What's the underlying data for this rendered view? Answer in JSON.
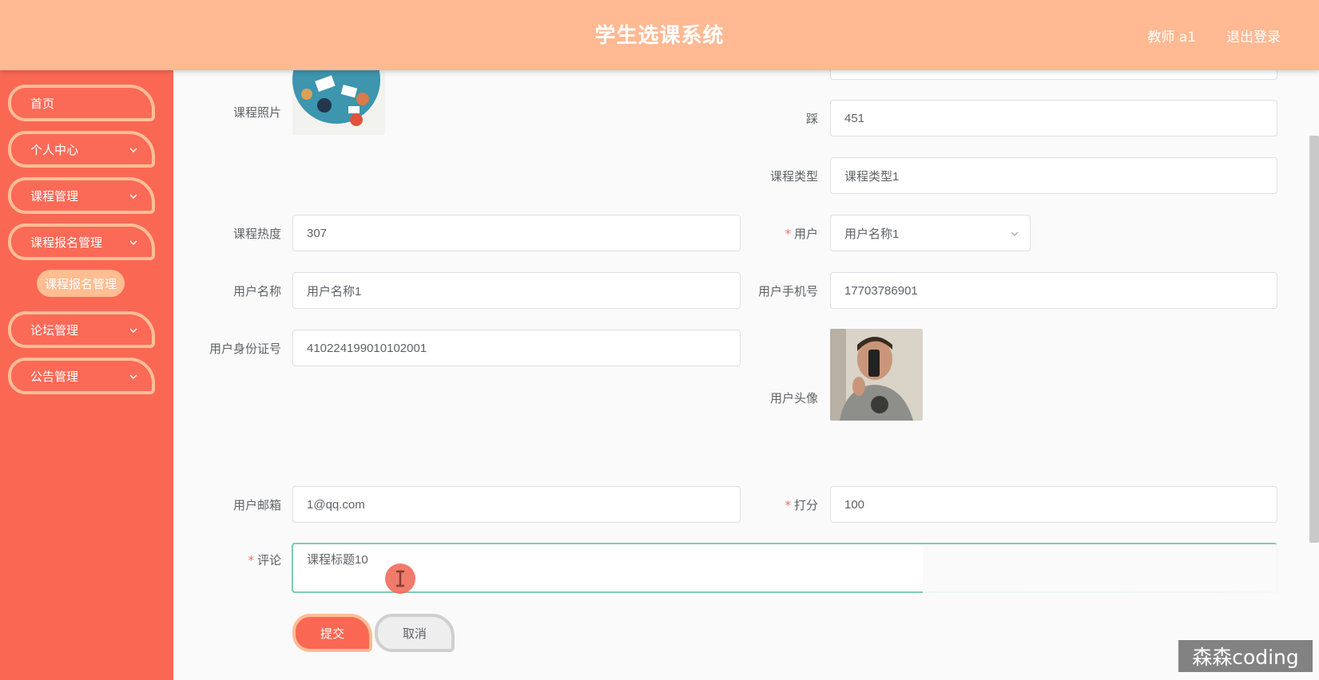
{
  "header": {
    "title": "学生选课系统",
    "user": "教师 a1",
    "logout": "退出登录"
  },
  "sidebar": {
    "items": [
      {
        "label": "首页"
      },
      {
        "label": "个人中心"
      },
      {
        "label": "课程管理"
      },
      {
        "label": "课程报名管理"
      },
      {
        "label": "论坛管理"
      },
      {
        "label": "公告管理"
      }
    ],
    "submenu_active": "课程报名管理"
  },
  "form": {
    "course_photo_label": "课程照片",
    "cai_label": "踩",
    "cai_value": "451",
    "course_type_label": "课程类型",
    "course_type_value": "课程类型1",
    "heat_label": "课程热度",
    "heat_value": "307",
    "user_label": "用户",
    "user_select_value": "用户名称1",
    "username_label": "用户名称",
    "username_value": "用户名称1",
    "phone_label": "用户手机号",
    "phone_value": "17703786901",
    "idcard_label": "用户身份证号",
    "idcard_value": "410224199010102001",
    "avatar_label": "用户头像",
    "email_label": "用户邮箱",
    "email_value": "1@qq.com",
    "score_label": "打分",
    "score_value": "100",
    "comment_label": "评论",
    "comment_value": "课程标题10",
    "required_mark": "*"
  },
  "buttons": {
    "submit": "提交",
    "cancel": "取消"
  },
  "watermark": "森森coding",
  "colors": {
    "header_bg": "#ffb993",
    "sidebar_bg": "#fa6854",
    "accent_border": "#ffbe97",
    "required": "#f56c6c",
    "focus_border": "#7ecbb2"
  }
}
